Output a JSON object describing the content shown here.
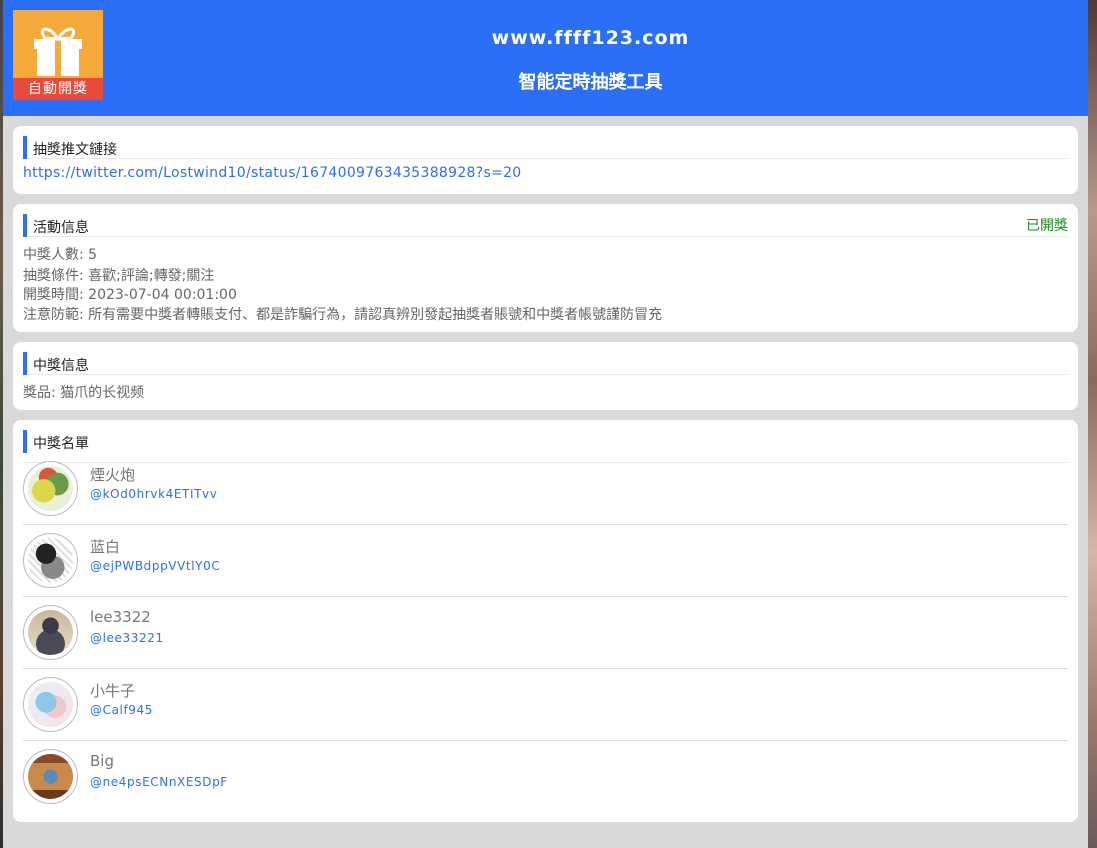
{
  "header": {
    "logo_text": "自動開獎",
    "site_url": "www.ffff123.com",
    "title": "智能定時抽獎工具"
  },
  "tweet_card": {
    "title": "抽獎推文鏈接",
    "link": "https://twitter.com/Lostwind10/status/1674009763435388928?s=20"
  },
  "activity_card": {
    "title": "活動信息",
    "status": "已開獎",
    "lines": [
      "中獎人數: 5",
      "抽獎條件: 喜歡;評論;轉發;關注",
      "開獎時間: 2023-07-04 00:01:00",
      "注意防範: 所有需要中獎者轉賬支付、都是詐騙行為，請認真辨別發起抽獎者賬號和中獎者帳號謹防冒充"
    ]
  },
  "prize_card": {
    "title": "中獎信息",
    "prize_line": "獎品: 猫爪的长视频"
  },
  "winners_card": {
    "title": "中獎名單",
    "winners": [
      {
        "name": "煙火炮",
        "handle": "@kOd0hrvk4ETITvv"
      },
      {
        "name": "蓝白",
        "handle": "@ejPWBdppVVtlY0C"
      },
      {
        "name": "lee3322",
        "handle": "@lee33221"
      },
      {
        "name": "小牛子",
        "handle": "@Calf945"
      },
      {
        "name": "Big",
        "handle": "@ne4psECNnXESDpF"
      }
    ]
  },
  "colors": {
    "brand_blue": "#2a6ff6",
    "logo_orange": "#f4a93a",
    "logo_red": "#e84b3c",
    "status_green": "#1a8a1a"
  }
}
